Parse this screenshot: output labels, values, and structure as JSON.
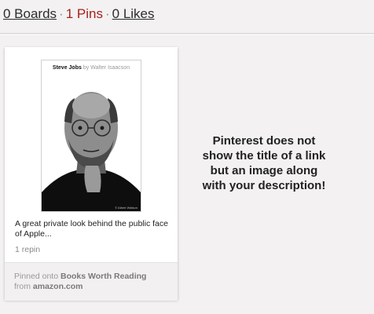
{
  "stats": {
    "boards": "0 Boards",
    "pins": "1 Pins",
    "likes": "0 Likes",
    "separator": "·"
  },
  "pin": {
    "cover": {
      "title": "Steve Jobs",
      "author": "by Walter Isaacson",
      "credit": "© Albert Watson"
    },
    "description": "A great private look behind the public face of Apple...",
    "repins": "1 repin",
    "pinned_onto": {
      "prefix": "Pinned onto",
      "board": "Books Worth Reading",
      "from_label": "from",
      "source": "amazon.com"
    }
  },
  "note": "Pinterest does not show the title of a link but an image along with your description!",
  "colors": {
    "background": "#f3f1f1",
    "active_tab": "#a6201e",
    "card": "#ffffff",
    "card_footer": "#f2f0f0"
  }
}
